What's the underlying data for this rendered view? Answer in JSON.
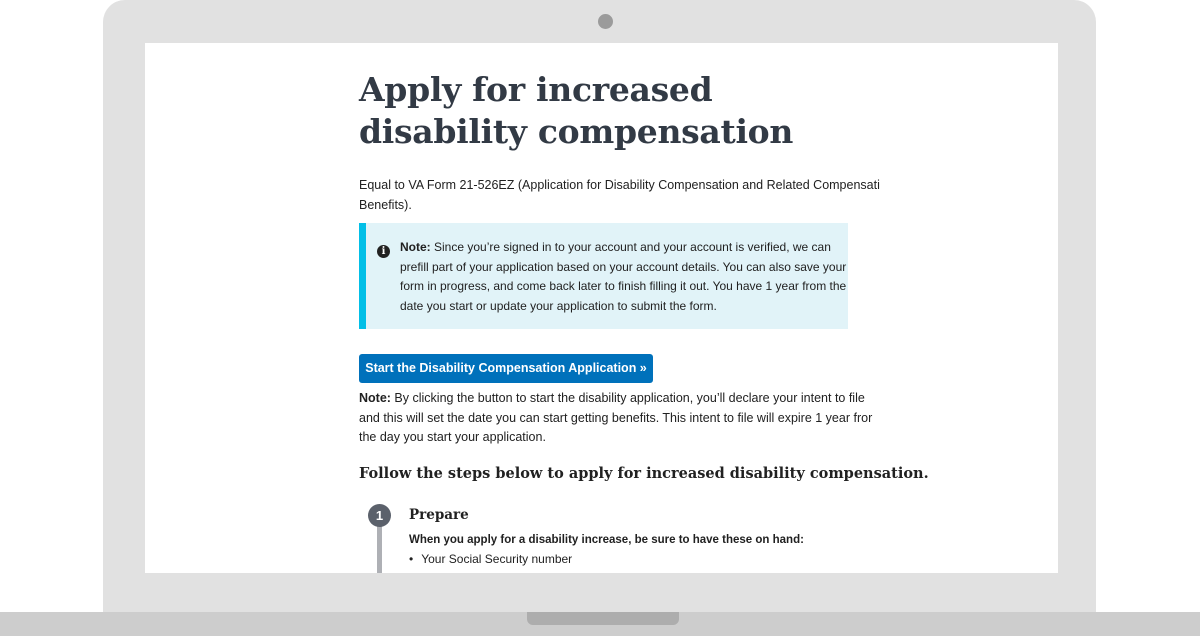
{
  "page": {
    "title": "Apply for increased disability compensation",
    "intro_lines": [
      "Equal to VA Form 21-526EZ (Application for Disability Compensation and Related Compensati",
      "Benefits)."
    ]
  },
  "alert": {
    "icon": "info-icon",
    "label": "Note:",
    "lines": [
      " Since you’re signed in to your account and your account is verified, we can",
      "prefill part of your application based on your account details. You can also save your",
      "form in progress, and come back later to finish filling it out. You have 1 year from the",
      "date you start or update your application to submit the form."
    ]
  },
  "start_button": {
    "label": "Start the Disability Compensation Application »"
  },
  "note": {
    "label": "Note:",
    "lines": [
      " By clicking the button to start the disability application, you’ll declare your intent to file",
      "and this will set the date you can start getting benefits. This intent to file will expire 1 year fror",
      "the day you start your application."
    ]
  },
  "steps": {
    "heading": "Follow the steps below to apply for increased disability compensation.",
    "items": [
      {
        "number": "1",
        "title": "Prepare",
        "subheading": "When you apply for a disability increase, be sure to have these on hand:",
        "bullets": [
          "Your Social Security number"
        ]
      }
    ]
  },
  "colors": {
    "primary_button": "#0071bb",
    "alert_background": "#e1f3f8",
    "alert_border": "#02bfe7",
    "heading_text": "#323a45",
    "step_badge": "#5b616b"
  }
}
